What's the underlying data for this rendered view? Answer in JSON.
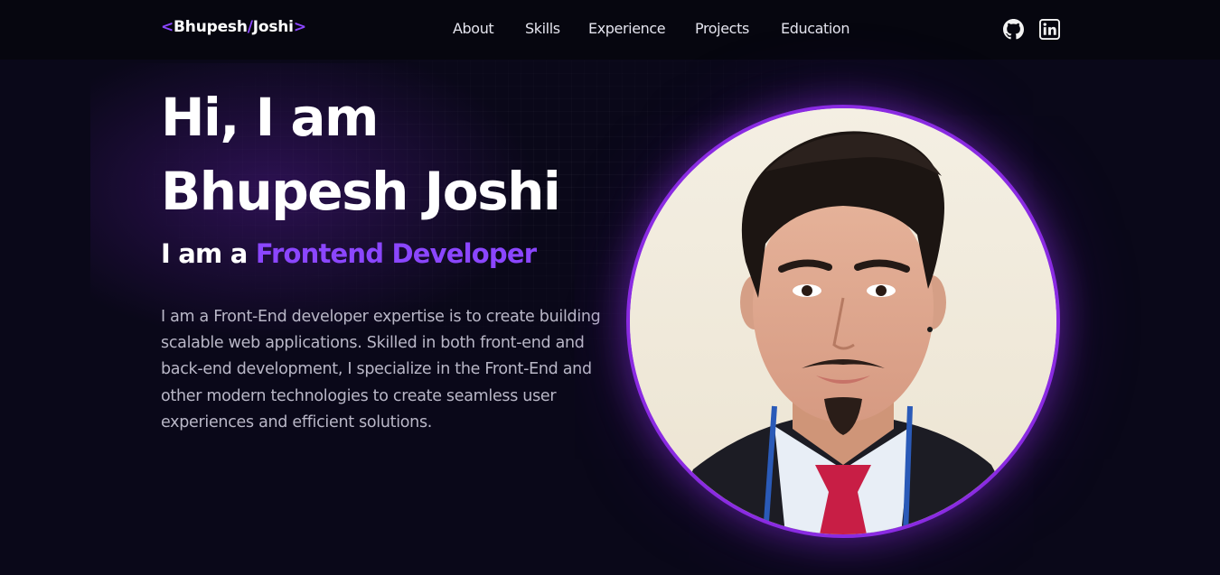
{
  "header": {
    "logo": {
      "open": "<",
      "first": "Bhupesh",
      "slash": "/",
      "last": "Joshi",
      "close": ">"
    },
    "nav": [
      "About",
      "Skills",
      "Experience",
      "Projects",
      "Education"
    ],
    "social": [
      {
        "icon": "github-icon"
      },
      {
        "icon": "linkedin-icon"
      }
    ]
  },
  "hero": {
    "line1": "Hi, I am",
    "line2": "Bhupesh Joshi",
    "role_prefix": "I am a",
    "role_highlight": "Frontend Developer",
    "bio": "I am a Front-End developer expertise is to create building scalable web applications. Skilled in both front-end and back-end development, I specialize in the Front-End and other modern technologies to create seamless user experiences and efficient solutions.",
    "avatar_icon": "profile-photo"
  },
  "colors": {
    "background": "#0a0819",
    "nav_background": "#06060f",
    "accent": "#8b46ff",
    "ring": "#8a2be2",
    "body_text": "#b9b7c7"
  }
}
